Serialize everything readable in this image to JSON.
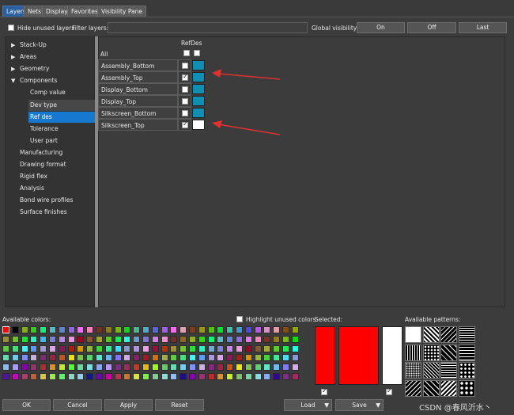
{
  "tabs": [
    {
      "label": "Layers",
      "active": true
    },
    {
      "label": "Nets",
      "active": false
    },
    {
      "label": "Display",
      "active": false
    },
    {
      "label": "Favorites",
      "active": false
    },
    {
      "label": "Visibility Pane",
      "active": false
    }
  ],
  "filter": {
    "hide_unused_label": "Hide unused layers",
    "hide_unused_checked": false,
    "filter_label": "Filter layers:",
    "filter_value": "",
    "global_visibility_label": "Global visibility:",
    "on_label": "On",
    "off_label": "Off",
    "last_label": "Last"
  },
  "tree": [
    {
      "label": "Stack-Up",
      "expander": "▶",
      "indent": 0
    },
    {
      "label": "Areas",
      "expander": "▶",
      "indent": 0
    },
    {
      "label": "Geometry",
      "expander": "▶",
      "indent": 0
    },
    {
      "label": "Components",
      "expander": "▼",
      "indent": 0
    },
    {
      "label": "Comp value",
      "expander": "",
      "indent": 1
    },
    {
      "label": "Dev type",
      "expander": "",
      "indent": 1,
      "state": "hover"
    },
    {
      "label": "Ref des",
      "expander": "",
      "indent": 1,
      "state": "selected"
    },
    {
      "label": "Tolerance",
      "expander": "",
      "indent": 1
    },
    {
      "label": "User part",
      "expander": "",
      "indent": 1
    },
    {
      "label": "Manufacturing",
      "expander": "",
      "indent": 0
    },
    {
      "label": "Drawing format",
      "expander": "",
      "indent": 0
    },
    {
      "label": "Rigid flex",
      "expander": "",
      "indent": 0
    },
    {
      "label": "Analysis",
      "expander": "",
      "indent": 0
    },
    {
      "label": "Bond wire profiles",
      "expander": "",
      "indent": 0
    },
    {
      "label": "Surface finishes",
      "expander": "",
      "indent": 0
    }
  ],
  "grid": {
    "column_header": "RefDes",
    "all_label": "All",
    "rows": [
      {
        "name": "Assembly_Bottom",
        "checked": false,
        "color": "#0e8fb5"
      },
      {
        "name": "Assembly_Top",
        "checked": true,
        "color": "#0e8fb5"
      },
      {
        "name": "Display_Bottom",
        "checked": false,
        "color": "#0e8fb5"
      },
      {
        "name": "Display_Top",
        "checked": false,
        "color": "#0e8fb5"
      },
      {
        "name": "Silkscreen_Bottom",
        "checked": false,
        "color": "#0e8fb5"
      },
      {
        "name": "Silkscreen_Top",
        "checked": true,
        "color": "#ffffff"
      }
    ]
  },
  "bottom": {
    "available_colors_label": "Available colors:",
    "highlight_unused_label": "Highlight unused colors",
    "highlight_unused_checked": false,
    "selected_label": "Selected:",
    "available_patterns_label": "Available patterns:",
    "selected_primary_color": "#ff0000",
    "selected_secondary_color": "#ffffff"
  },
  "buttons": {
    "ok": "OK",
    "cancel": "Cancel",
    "apply": "Apply",
    "reset": "Reset",
    "load": "Load",
    "save": "Save"
  },
  "watermark": "CSDN @春风沂水丶",
  "colors": {
    "accent_tab": "#2b5f9e",
    "selection": "#1778d0",
    "annotation_arrow": "#e03030"
  }
}
